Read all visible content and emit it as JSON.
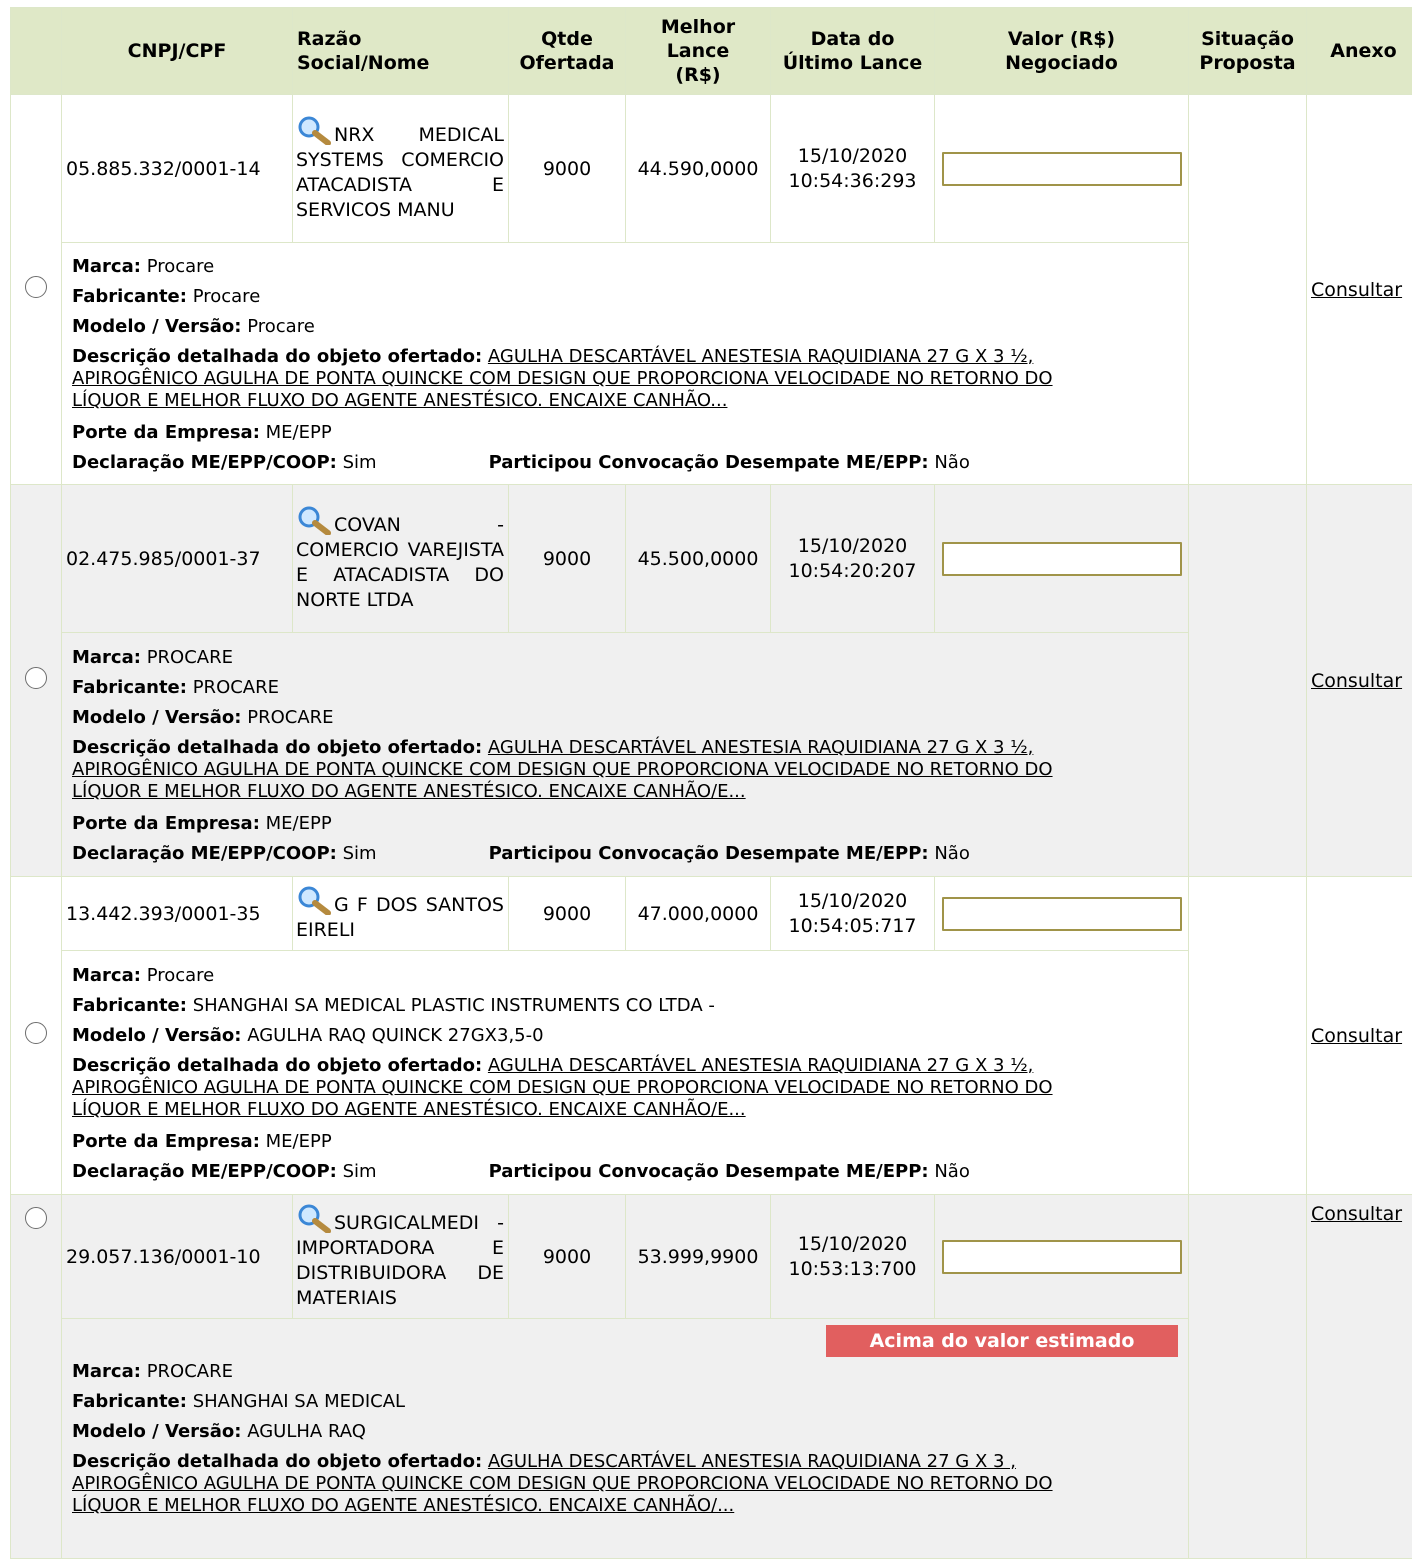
{
  "headers": {
    "cnpj": "CNPJ/CPF",
    "razao": "Razão Social/Nome",
    "qtde": "Qtde Ofertada",
    "melhor_lance": "Melhor Lance (R$)",
    "data": "Data do Último Lance",
    "valor": "Valor (R$) Negociado",
    "situacao": "Situação Proposta",
    "anexo": "Anexo"
  },
  "labels": {
    "marca": "Marca:",
    "fabricante": "Fabricante:",
    "modelo": "Modelo / Versão:",
    "descricao": "Descrição detalhada do objeto ofertado:",
    "porte": "Porte da Empresa:",
    "declaracao": "Declaração ME/EPP/COOP:",
    "participou": "Participou Convocação Desempate ME/EPP:",
    "consultar": "Consultar"
  },
  "rows": [
    {
      "cnpj": "05.885.332/0001-14",
      "razao": "NRX MEDICAL SYSTEMS COMERCIO ATACADISTA E SERVICOS MANU",
      "qtde": "9000",
      "lance": "44.590,0000",
      "data": "15/10/2020",
      "hora": "10:54:36:293",
      "valor": "",
      "marca": "Procare",
      "fabricante": "Procare",
      "modelo": "Procare",
      "descricao_1": "AGULHA DESCARTÁVEL ANESTESIA RAQUIDIANA 27 G X 3 ½,",
      "descricao_2": "APIROGÊNICO AGULHA DE PONTA QUINCKE COM DESIGN QUE PROPORCIONA VELOCIDADE NO RETORNO DO",
      "descricao_3": "LÍQUOR E MELHOR FLUXO DO AGENTE ANESTÉSICO. ENCAIXE CANHÃO...",
      "porte": "ME/EPP",
      "declaracao": "Sim",
      "participou": "Não"
    },
    {
      "cnpj": "02.475.985/0001-37",
      "razao": "COVAN - COMERCIO VAREJISTA E ATACADISTA DO NORTE LTDA",
      "qtde": "9000",
      "lance": "45.500,0000",
      "data": "15/10/2020",
      "hora": "10:54:20:207",
      "valor": "",
      "marca": "PROCARE",
      "fabricante": "PROCARE",
      "modelo": "PROCARE",
      "descricao_1": "AGULHA DESCARTÁVEL ANESTESIA RAQUIDIANA 27 G X 3 ½,",
      "descricao_2": "APIROGÊNICO AGULHA DE PONTA QUINCKE COM DESIGN QUE PROPORCIONA VELOCIDADE NO RETORNO DO",
      "descricao_3": "LÍQUOR E MELHOR FLUXO DO AGENTE ANESTÉSICO. ENCAIXE CANHÃO/E...",
      "porte": "ME/EPP",
      "declaracao": "Sim",
      "participou": "Não"
    },
    {
      "cnpj": "13.442.393/0001-35",
      "razao": "G F DOS SANTOS EIRELI",
      "qtde": "9000",
      "lance": "47.000,0000",
      "data": "15/10/2020",
      "hora": "10:54:05:717",
      "valor": "",
      "marca": "Procare",
      "fabricante": "SHANGHAI SA MEDICAL PLASTIC INSTRUMENTS CO LTDA -",
      "modelo": "AGULHA RAQ QUINCK 27GX3,5-0",
      "descricao_1": "AGULHA DESCARTÁVEL ANESTESIA RAQUIDIANA 27 G X 3 ½,",
      "descricao_2": "APIROGÊNICO AGULHA DE PONTA QUINCKE COM DESIGN QUE PROPORCIONA VELOCIDADE NO RETORNO DO",
      "descricao_3": "LÍQUOR E MELHOR FLUXO DO AGENTE ANESTÉSICO. ENCAIXE CANHÃO/E...",
      "porte": "ME/EPP",
      "declaracao": "Sim",
      "participou": "Não"
    },
    {
      "cnpj": "29.057.136/0001-10",
      "razao": "SURGICALMEDI - IMPORTADORA E DISTRIBUIDORA DE MATERIAIS",
      "qtde": "9000",
      "lance": "53.999,9900",
      "data": "15/10/2020",
      "hora": "10:53:13:700",
      "valor": "",
      "marca": "PROCARE",
      "fabricante": "SHANGHAI SA MEDICAL",
      "modelo": "AGULHA RAQ",
      "descricao_1": "AGULHA DESCARTÁVEL ANESTESIA RAQUIDIANA 27 G X 3 ,",
      "descricao_2": "APIROGÊNICO AGULHA DE PONTA QUINCKE COM DESIGN QUE PROPORCIONA VELOCIDADE NO RETORNO DO",
      "descricao_3": "LÍQUOR E MELHOR FLUXO DO AGENTE ANESTÉSICO. ENCAIXE CANHÃO/...",
      "badge": "Acima do valor estimado"
    }
  ],
  "colors": {
    "header_bg": "#dfe8c7",
    "row_alt_bg": "#f0f0f0",
    "badge_bg": "#e15f5f",
    "input_border": "#a09449"
  },
  "icons": {
    "magnifier": "magnifier-icon",
    "radio": "radio-button"
  }
}
